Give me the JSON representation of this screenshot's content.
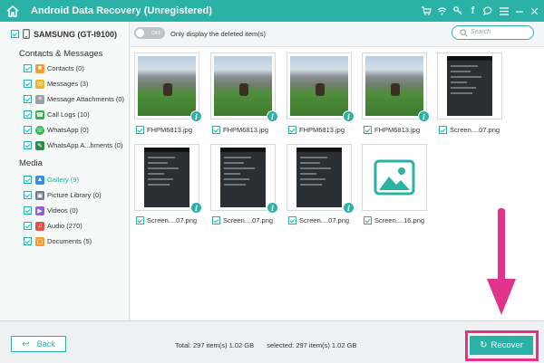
{
  "app": {
    "title": "Android Data Recovery (Unregistered)",
    "accent": "#2ab2a7",
    "toolbar_icons": [
      "cart-icon",
      "wifi-icon",
      "key-icon",
      "facebook-icon",
      "chat-icon",
      "menu-icon",
      "minimize-icon",
      "close-icon"
    ]
  },
  "sidebar": {
    "device": "SAMSUNG (GT-I9100)",
    "sections": [
      {
        "title": "Contacts & Messages",
        "items": [
          {
            "label": "Contacts (0)",
            "icon": "contacts-icon",
            "color": "#f39c32",
            "checked": false
          },
          {
            "label": "Messages (3)",
            "icon": "messages-icon",
            "color": "#f0b323",
            "checked": true
          },
          {
            "label": "Message Attachments (0)",
            "icon": "attachment-icon",
            "color": "#9aa2a5",
            "checked": false
          },
          {
            "label": "Call Logs (10)",
            "icon": "call-icon",
            "color": "#34b04c",
            "checked": true
          },
          {
            "label": "WhatsApp (0)",
            "icon": "whatsapp-icon",
            "color": "#34b04c",
            "checked": false
          },
          {
            "label": "WhatsApp A...hments (0)",
            "icon": "whatsapp-attachment-icon",
            "color": "#2f8a4a",
            "checked": false
          }
        ]
      },
      {
        "title": "Media",
        "items": [
          {
            "label": "Gallery (9)",
            "icon": "gallery-icon",
            "color": "#3a8de0",
            "checked": true,
            "active": true
          },
          {
            "label": "Picture Library (0)",
            "icon": "picture-library-icon",
            "color": "#6c7a89",
            "checked": false
          },
          {
            "label": "Videos (0)",
            "icon": "video-icon",
            "color": "#8e5fd6",
            "checked": false
          },
          {
            "label": "Audio (270)",
            "icon": "audio-icon",
            "color": "#e0534b",
            "checked": true
          },
          {
            "label": "Documents (5)",
            "icon": "documents-icon",
            "color": "#f39c32",
            "checked": true
          }
        ]
      }
    ]
  },
  "filter": {
    "toggle": "OFF",
    "label": "Only display the deleted item(s)",
    "search_placeholder": "Search"
  },
  "gallery": [
    {
      "name": "FHPM6813.jpg",
      "type": "landscape"
    },
    {
      "name": "FHPM6813.jpg",
      "type": "landscape"
    },
    {
      "name": "FHPM6813.jpg",
      "type": "landscape"
    },
    {
      "name": "FHPM6813.jpg",
      "type": "landscape"
    },
    {
      "name": "Screen....07.png",
      "type": "phone"
    },
    {
      "name": "Screen....07.png",
      "type": "phone"
    },
    {
      "name": "Screen....07.png",
      "type": "phone"
    },
    {
      "name": "Screen....07.png",
      "type": "phone"
    },
    {
      "name": "Screen....16.png",
      "type": "placeholder"
    }
  ],
  "footer": {
    "back": "Back",
    "total": "Total: 297 item(s) 1.02 GB",
    "selected": "selected: 297 item(s) 1.02 GB",
    "recover": "Recover"
  }
}
